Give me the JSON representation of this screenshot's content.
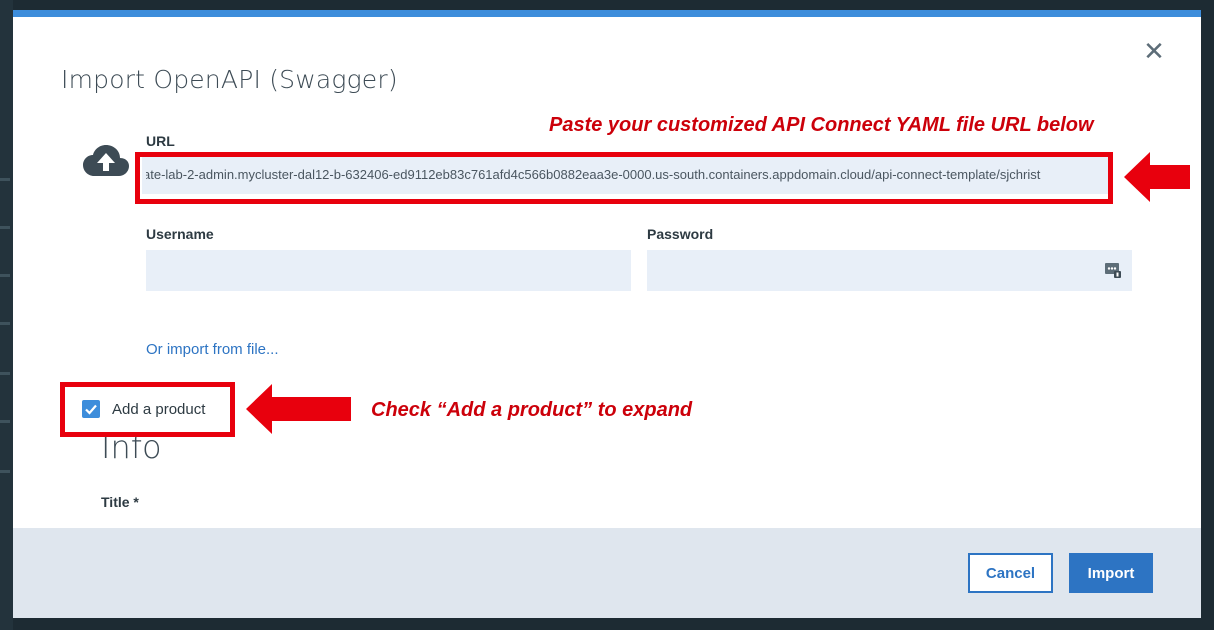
{
  "modal": {
    "title": "Import OpenAPI (Swagger)",
    "close_symbol": "✕",
    "upload_icon": "cloud-upload-icon"
  },
  "form": {
    "url_label": "URL",
    "url_value": "ate-lab-2-admin.mycluster-dal12-b-632406-ed9112eb83c761afd4c566b0882eaa3e-0000.us-south.containers.appdomain.cloud/api-connect-template/sjchrist",
    "username_label": "Username",
    "username_value": "",
    "password_label": "Password",
    "password_value": "",
    "password_icon": "password-key-icon",
    "import_file_link": "Or import from file...",
    "add_product_label": "Add a product",
    "add_product_checked": true
  },
  "info": {
    "heading": "Info",
    "title_label": "Title *"
  },
  "footer": {
    "cancel_label": "Cancel",
    "import_label": "Import"
  },
  "annotations": {
    "url_note": "Paste your customized API Connect YAML file URL below",
    "checkbox_note": "Check “Add a product” to expand"
  },
  "colors": {
    "accent": "#2d74c3",
    "annotation_red": "#e8000d",
    "input_bg": "#e8eff8",
    "footer_bg": "#dfe6ee"
  }
}
